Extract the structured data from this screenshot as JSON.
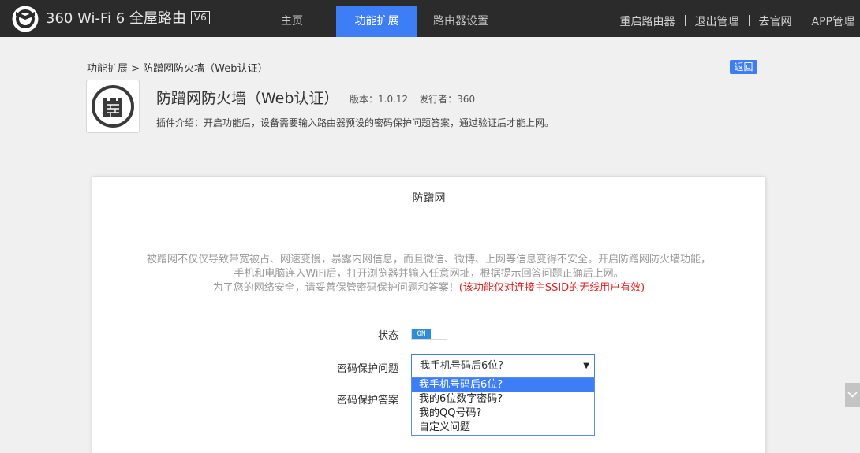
{
  "header": {
    "brand": "360 Wi-Fi 6 全屋路由",
    "brand_badge": "V6",
    "nav": [
      {
        "label": "主页"
      },
      {
        "label": "功能扩展"
      },
      {
        "label": "路由器设置"
      }
    ],
    "right_links": [
      {
        "label": "重启路由器"
      },
      {
        "label": "退出管理"
      },
      {
        "label": "去官网"
      },
      {
        "label": "APP管理"
      }
    ],
    "colors": {
      "bar": "#2b2b2b",
      "active_tab": "#3d7ef7"
    }
  },
  "page": {
    "breadcrumb": "功能扩展 > 防蹭网防火墙（Web认证）",
    "back_label": "返回",
    "plugin": {
      "icon": "castle-wall-icon",
      "title": "防蹭网防火墙（Web认证）",
      "version": "版本：1.0.12",
      "publisher": "发行者：360",
      "description": "插件介绍：开启功能后，设备需要输入路由器预设的密码保护问题答案，通过验证后才能上网。"
    }
  },
  "card": {
    "title": "防蹭网",
    "intro_line1": "被蹭网不仅仅导致带宽被占、网速变慢，暴露内网信息，而且微信、微博、上网等信息变得不安全。开启防蹭网防火墙功能，",
    "intro_line2": "手机和电脑连入WiFi后，打开浏览器并输入任意网址，根据提示回答问题正确后上网。",
    "intro_line3": "为了您的网络安全，请妥善保管密码保护问题和答案！",
    "intro_warning": "(该功能仅对连接主SSID的无线用户有效)",
    "status_label": "状态",
    "status_value": "ON",
    "question_label": "密码保护问题",
    "answer_label": "密码保护答案",
    "question_selected": "我手机号码后6位?",
    "question_options": [
      "我手机号码后6位?",
      "我的6位数字密码?",
      "我的QQ号码?",
      "自定义问题"
    ]
  }
}
